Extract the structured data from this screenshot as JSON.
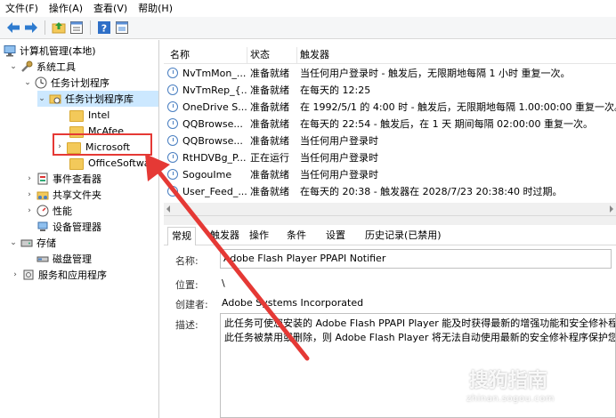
{
  "menu": [
    "文件(F)",
    "操作(A)",
    "查看(V)",
    "帮助(H)"
  ],
  "tree": {
    "root": "计算机管理(本地)",
    "system_tools": "系统工具",
    "task_scheduler": "任务计划程序",
    "task_library": "任务计划程序库",
    "folders": [
      "Intel",
      "McAfee",
      "Microsoft",
      "OfficeSoftware"
    ],
    "event_viewer": "事件查看器",
    "shared_folders": "共享文件夹",
    "performance": "性能",
    "device_manager": "设备管理器",
    "storage": "存储",
    "disk_management": "磁盘管理",
    "services_apps": "服务和应用程序"
  },
  "table": {
    "headers": [
      "名称",
      "状态",
      "触发器"
    ],
    "rows": [
      {
        "name": "NvTmMon_...",
        "status": "准备就绪",
        "trigger": "当任何用户登录时 - 触发后，无限期地每隔 1 小时 重复一次。"
      },
      {
        "name": "NvTmRep_{...",
        "status": "准备就绪",
        "trigger": "在每天的 12:25"
      },
      {
        "name": "OneDrive S...",
        "status": "准备就绪",
        "trigger": "在 1992/5/1 的 4:00 时 - 触发后，无限期地每隔 1.00:00:00 重复一次。"
      },
      {
        "name": "QQBrowse...",
        "status": "准备就绪",
        "trigger": "在每天的 22:54 - 触发后，在 1 天 期间每隔 02:00:00 重复一次。"
      },
      {
        "name": "QQBrowse...",
        "status": "准备就绪",
        "trigger": "当任何用户登录时"
      },
      {
        "name": "RtHDVBg_P...",
        "status": "正在运行",
        "trigger": "当任何用户登录时"
      },
      {
        "name": "SogouIme",
        "status": "准备就绪",
        "trigger": "当任何用户登录时"
      },
      {
        "name": "User_Feed_...",
        "status": "准备就绪",
        "trigger": "在每天的 20:38 - 触发器在 2028/7/23 20:38:40 时过期。"
      }
    ]
  },
  "tabs": [
    "常规",
    "触发器",
    "操作",
    "条件",
    "设置",
    "历史记录(已禁用)"
  ],
  "detail": {
    "name_label": "名称:",
    "name_value": "Adobe Flash Player PPAPI Notifier",
    "location_label": "位置:",
    "location_value": "\\",
    "author_label": "创建者:",
    "author_value": "Adobe Systems Incorporated",
    "desc_label": "描述:",
    "desc_line1": "此任务可使您安装的 Adobe Flash PPAPI Player 能及时获得最新的增强功能和安全修补程序",
    "desc_line2": "此任务被禁用或删除，则 Adobe Flash Player 将无法自动使用最新的安全修补程序保护您的"
  },
  "watermark": {
    "line1": "搜狗指南",
    "line2": "zhinan.sogou.com"
  },
  "colors": {
    "selection": "#cce8ff",
    "highlight_box": "#e53935",
    "arrow": "#e53935"
  }
}
